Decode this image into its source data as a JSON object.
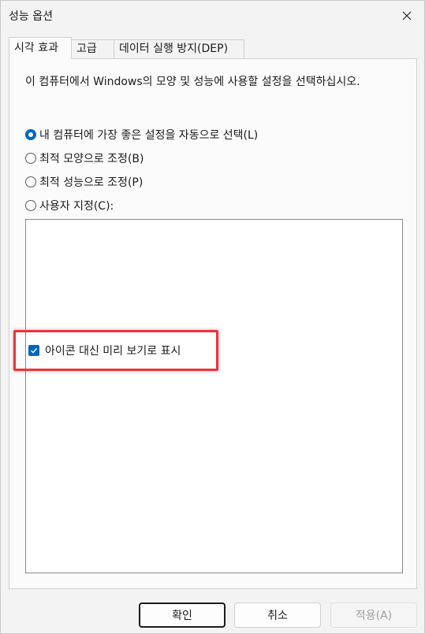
{
  "window": {
    "title": "성능 옵션"
  },
  "tabs": [
    {
      "label": "시각 효과",
      "active": true
    },
    {
      "label": "고급",
      "active": false
    },
    {
      "label": "데이터 실행 방지(DEP)",
      "active": false
    }
  ],
  "visual_effects": {
    "description": "이 컴퓨터에서 Windows의 모양 및 성능에 사용할 설정을 선택하십시오.",
    "options": [
      {
        "label": "내 컴퓨터에 가장 좋은 설정을 자동으로 선택(L)",
        "checked": true
      },
      {
        "label": "최적 모양으로 조정(B)",
        "checked": false
      },
      {
        "label": "최적 성능으로 조정(P)",
        "checked": false
      },
      {
        "label": "사용자 지정(C):",
        "checked": false
      }
    ],
    "list_items": [
      {
        "label": "아이콘 대신 미리 보기로 표시",
        "checked": true
      }
    ]
  },
  "buttons": {
    "ok": "확인",
    "cancel": "취소",
    "apply": "적용(A)"
  },
  "colors": {
    "accent": "#0067c0",
    "highlight": "#e8363d"
  },
  "icons": {
    "close": "close-icon",
    "check": "checkmark-icon"
  }
}
